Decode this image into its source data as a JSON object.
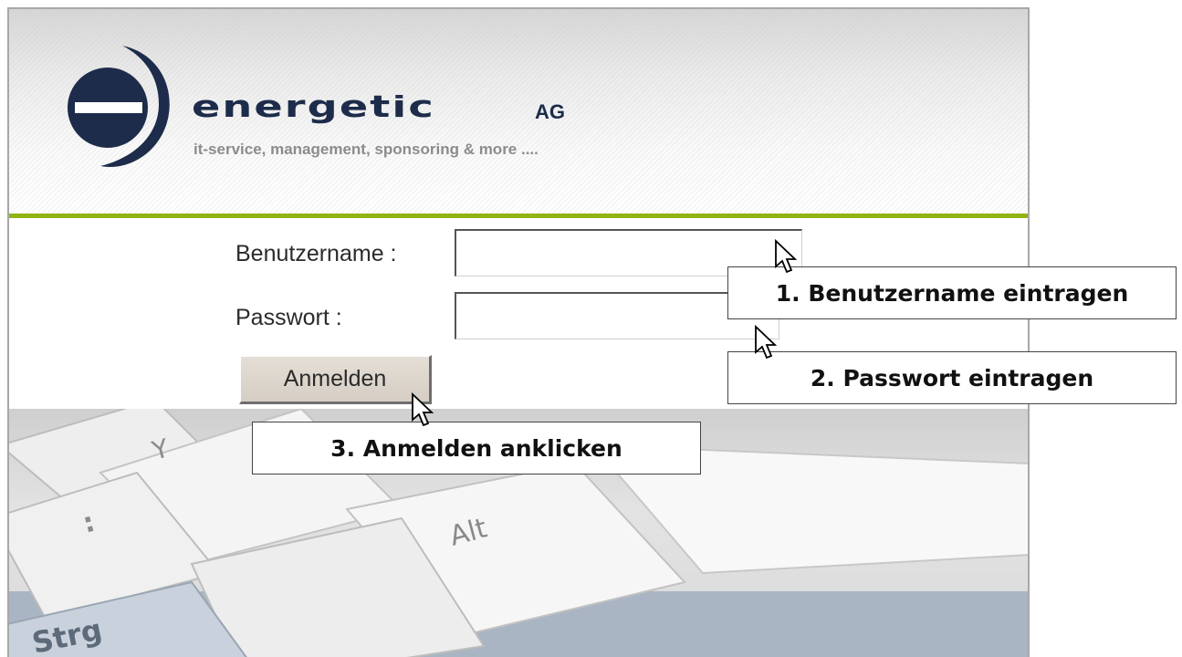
{
  "brand": {
    "wordmark": "energetic",
    "suffix": "AG",
    "tagline": "it-service, management, sponsoring & more ....",
    "green": "#8fb414",
    "navy": "#1c2c4a"
  },
  "form": {
    "username_label": "Benutzername :",
    "username_value": "",
    "password_label": "Passwort :",
    "password_value": "",
    "login_button": "Anmelden"
  },
  "keyboard": {
    "keys": [
      "Y",
      ":",
      "Alt",
      "Strg"
    ]
  },
  "instructions": {
    "step1": "1. Benutzername eintragen",
    "step2": "2. Passwort eintragen",
    "step3": "3. Anmelden anklicken"
  }
}
